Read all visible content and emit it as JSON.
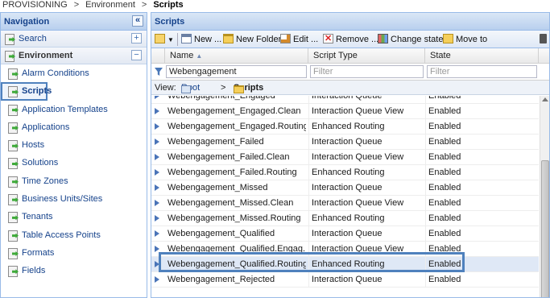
{
  "breadcrumb": {
    "root": "PROVISIONING",
    "sep1": ">",
    "mid": "Environment",
    "sep2": ">",
    "current": "Scripts"
  },
  "nav": {
    "title": "Navigation",
    "collapse": "«",
    "search": {
      "label": "Search",
      "toggle": "+"
    },
    "environment": {
      "label": "Environment",
      "toggle": "−"
    },
    "items": [
      {
        "label": "Alarm Conditions"
      },
      {
        "label": "Scripts"
      },
      {
        "label": "Application Templates"
      },
      {
        "label": "Applications"
      },
      {
        "label": "Hosts"
      },
      {
        "label": "Solutions"
      },
      {
        "label": "Time Zones"
      },
      {
        "label": "Business Units/Sites"
      },
      {
        "label": "Tenants"
      },
      {
        "label": "Table Access Points"
      },
      {
        "label": "Formats"
      },
      {
        "label": "Fields"
      }
    ]
  },
  "main": {
    "title": "Scripts",
    "toolbar": {
      "new": "New ...",
      "new_folder": "New Folder",
      "edit": "Edit ...",
      "remove": "Remove ...",
      "change_state": "Change state",
      "move_to": "Move to"
    },
    "columns": {
      "name": "Name",
      "script_type": "Script Type",
      "state": "State"
    },
    "filters": {
      "name_value": "Webengagement",
      "placeholder": "Filter"
    },
    "view": {
      "label": "View:",
      "root": "Root",
      "sep": ">",
      "folder": "Scripts"
    },
    "rows": [
      {
        "name": "Webengagement_Engaged",
        "type": "Interaction Queue",
        "state": "Enabled"
      },
      {
        "name": "Webengagement_Engaged.Clean",
        "type": "Interaction Queue View",
        "state": "Enabled"
      },
      {
        "name": "Webengagement_Engaged.Routing",
        "type": "Enhanced Routing",
        "state": "Enabled"
      },
      {
        "name": "Webengagement_Failed",
        "type": "Interaction Queue",
        "state": "Enabled"
      },
      {
        "name": "Webengagement_Failed.Clean",
        "type": "Interaction Queue View",
        "state": "Enabled"
      },
      {
        "name": "Webengagement_Failed.Routing",
        "type": "Enhanced Routing",
        "state": "Enabled"
      },
      {
        "name": "Webengagement_Missed",
        "type": "Interaction Queue",
        "state": "Enabled"
      },
      {
        "name": "Webengagement_Missed.Clean",
        "type": "Interaction Queue View",
        "state": "Enabled"
      },
      {
        "name": "Webengagement_Missed.Routing",
        "type": "Enhanced Routing",
        "state": "Enabled"
      },
      {
        "name": "Webengagement_Qualified",
        "type": "Interaction Queue",
        "state": "Enabled"
      },
      {
        "name": "Webengagement_Qualified.Engag...",
        "type": "Interaction Queue View",
        "state": "Enabled"
      },
      {
        "name": "Webengagement_Qualified.Routing",
        "type": "Enhanced Routing",
        "state": "Enabled"
      },
      {
        "name": "Webengagement_Rejected",
        "type": "Interaction Queue",
        "state": "Enabled"
      }
    ]
  }
}
